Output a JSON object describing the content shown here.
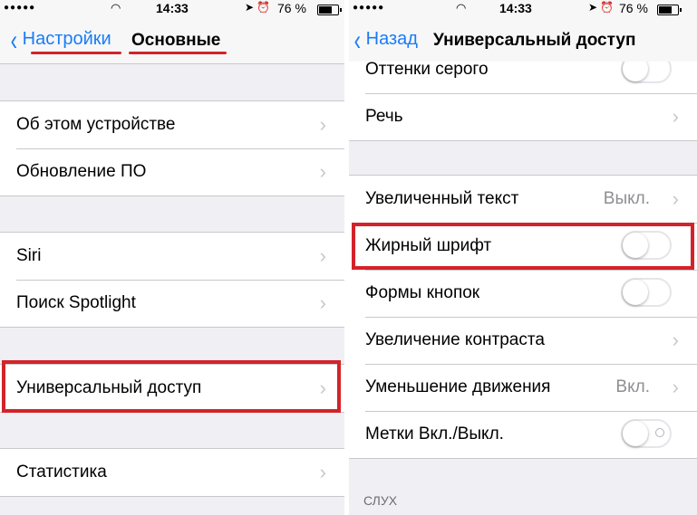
{
  "left": {
    "status": {
      "time": "14:33",
      "battery": "76 %"
    },
    "nav": {
      "back": "Настройки",
      "title": "Основные"
    },
    "groups": [
      {
        "rows": [
          {
            "label": "Об этом устройстве"
          },
          {
            "label": "Обновление ПО"
          }
        ]
      },
      {
        "rows": [
          {
            "label": "Siri"
          },
          {
            "label": "Поиск Spotlight"
          }
        ]
      },
      {
        "rows": [
          {
            "label": "Универсальный доступ"
          }
        ]
      },
      {
        "rows": [
          {
            "label": "Статистика"
          }
        ]
      }
    ]
  },
  "right": {
    "status": {
      "time": "14:33",
      "battery": "76 %"
    },
    "nav": {
      "back": "Назад",
      "title": "Универсальный доступ"
    },
    "group1": {
      "rows": [
        {
          "label": "Оттенки серого",
          "switch_on": false
        },
        {
          "label": "Речь"
        }
      ]
    },
    "group2": {
      "rows": [
        {
          "label": "Увеличенный текст",
          "value": "Выкл."
        },
        {
          "label": "Жирный шрифт",
          "switch_on": false
        },
        {
          "label": "Формы кнопок",
          "switch_on": false
        },
        {
          "label": "Увеличение контраста"
        },
        {
          "label": "Уменьшение движения",
          "value": "Вкл."
        },
        {
          "label": "Метки Вкл./Выкл.",
          "switch_on": false
        }
      ]
    },
    "section_header": "СЛУХ"
  },
  "colors": {
    "accent": "#1a7cf5",
    "highlight": "#d3232a",
    "background": "#efeff4"
  }
}
